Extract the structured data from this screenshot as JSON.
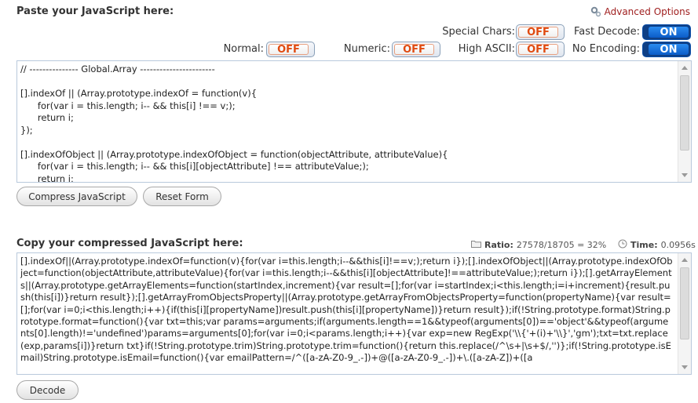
{
  "input_section": {
    "title": "Paste your JavaScript here:",
    "advanced_options_label": "Advanced Options"
  },
  "options": {
    "special_chars": {
      "label": "Special Chars:",
      "value": "OFF"
    },
    "fast_decode": {
      "label": "Fast Decode:",
      "value": "ON"
    },
    "normal": {
      "label": "Normal:",
      "value": "OFF"
    },
    "numeric": {
      "label": "Numeric:",
      "value": "OFF"
    },
    "high_ascii": {
      "label": "High ASCII:",
      "value": "OFF"
    },
    "no_encoding": {
      "label": "No Encoding:",
      "value": "ON"
    }
  },
  "input_code": "// --------------- Global.Array -----------------------\n\n[].indexOf || (Array.prototype.indexOf = function(v){\n      for(var i = this.length; i-- && this[i] !== v;);\n      return i;\n});\n\n[].indexOfObject || (Array.prototype.indexOfObject = function(objectAttribute, attributeValue){\n      for(var i = this.length; i-- && this[i][objectAttribute] !== attributeValue;);\n      return i;",
  "buttons": {
    "compress": "Compress JavaScript",
    "reset": "Reset Form",
    "decode": "Decode"
  },
  "output_section": {
    "title": "Copy your compressed JavaScript here:",
    "ratio_label": "Ratio:",
    "ratio_value": "27578/18705 = 32%",
    "time_label": "Time:",
    "time_value": "0.0956s"
  },
  "output_code": "[].indexOf||(Array.prototype.indexOf=function(v){for(var i=this.length;i--&&this[i]!==v;);return i});[].indexOfObject||(Array.prototype.indexOfObject=function(objectAttribute,attributeValue){for(var i=this.length;i--&&this[i][objectAttribute]!==attributeValue;);return i});[].getArrayElements||(Array.prototype.getArrayElements=function(startIndex,increment){var result=[];for(var i=startIndex;i<this.length;i=i+increment){result.push(this[i])}return result});[].getArrayFromObjectsProperty||(Array.prototype.getArrayFromObjectsProperty=function(propertyName){var result=[];for(var i=0;i<this.length;i++){if(this[i][propertyName])result.push(this[i][propertyName])}return result});if(!String.prototype.format)String.prototype.format=function(){var txt=this;var params=arguments;if(arguments.length==1&&typeof(arguments[0])=='object'&&typeof(arguments[0].length)!='undefined')params=arguments[0];for(var i=0;i<params.length;i++){var exp=new RegExp('\\\\{'+(i)+'\\\\}','gm');txt=txt.replace(exp,params[i])}return txt}if(!String.prototype.trim)String.prototype.trim=function(){return this.replace(/^\\s+|\\s+$/,'')};if(!String.prototype.isEmail)String.prototype.isEmail=function(){var emailPattern=/^([a-zA-Z0-9_.-])+@([a-zA-Z0-9_.-])+\\.([a-zA-Z])+([a",
  "colors": {
    "off_text": "#e04a10",
    "on_bg": "#0b5cc8",
    "advanced_link": "#a02020"
  },
  "icons": {
    "advanced": "gear-icon",
    "ratio": "folder-icon",
    "time": "clock-icon"
  }
}
